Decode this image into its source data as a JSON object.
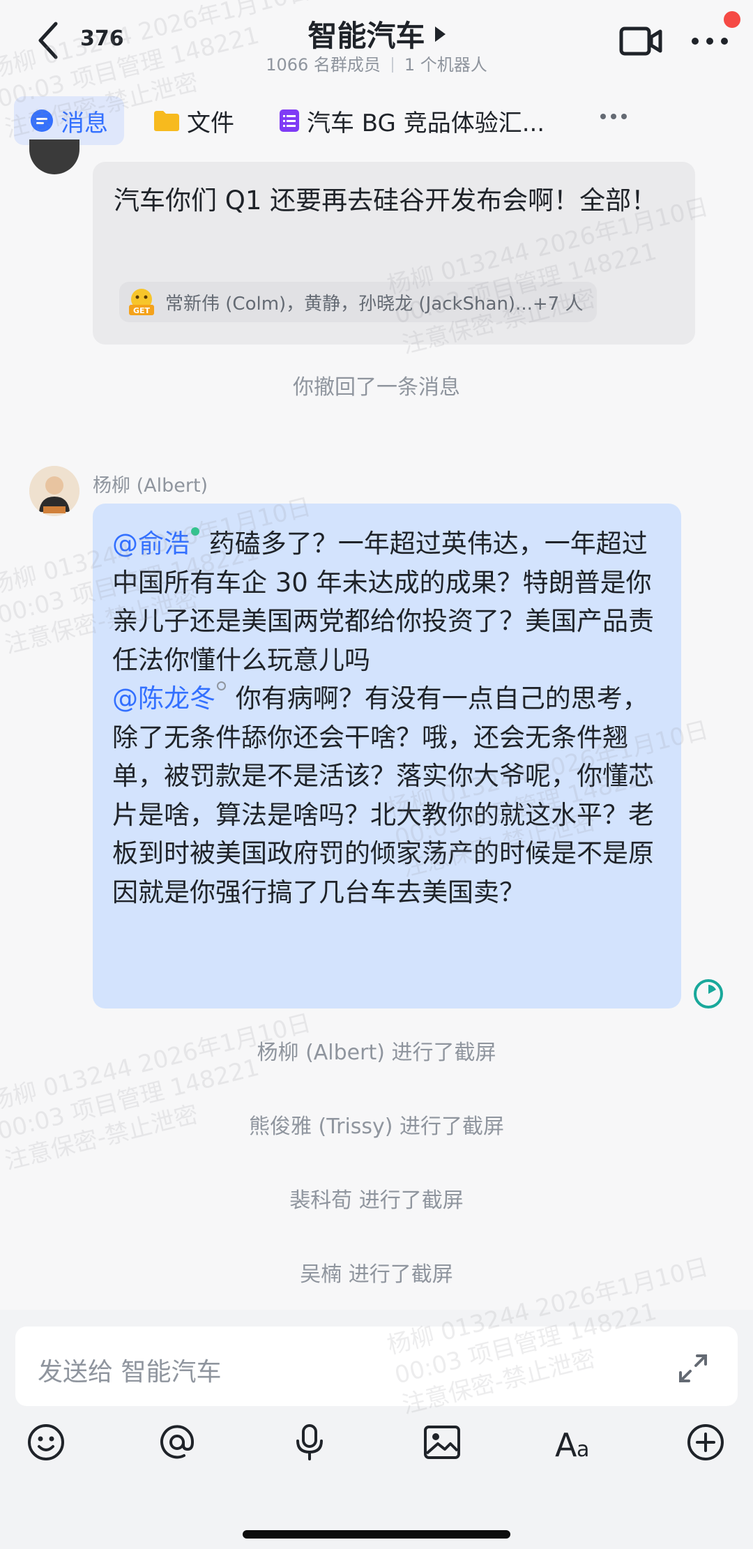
{
  "header": {
    "unread_count": "376",
    "title": "智能汽车",
    "member_count": "1066 名群成员",
    "bot_count": "1 个机器人"
  },
  "tabs": [
    {
      "label": "消息",
      "icon": "chat-bubble-icon",
      "active": true
    },
    {
      "label": "文件",
      "icon": "folder-icon",
      "active": false
    },
    {
      "label": "汽车 BG 竞品体验汇...",
      "icon": "doc-icon",
      "active": false
    }
  ],
  "messages": [
    {
      "text": "汽车你们 Q1 还要再去硅谷开发布会啊！全部！",
      "reaction": {
        "emoji": "get-emoji-icon",
        "users": "常新伟 (Colm)，黄静，孙晓龙 (JackShan)...+7 人"
      }
    },
    {
      "sender": "杨柳 (Albert)",
      "mention1": "@俞浩",
      "part1": " 药磕多了？一年超过英伟达，一年超过中国所有车企 30 年未达成的成果？特朗普是你亲儿子还是美国两党都给你投资了？美国产品责任法你懂什么玩意儿吗",
      "mention2": "@陈龙冬",
      "part2": " 你有病啊？有没有一点自己的思考，除了无条件舔你还会干啥？哦，还会无条件翘单，被罚款是不是活该？落实你大爷呢，你懂芯片是啥，算法是啥吗？北大教你的就这水平？老板到时被美国政府罚的倾家荡产的时候是不是原因就是你强行搞了几台车去美国卖？"
    }
  ],
  "system_messages": [
    "你撤回了一条消息",
    "杨柳 (Albert) 进行了截屏",
    "熊俊雅 (Trissy) 进行了截屏",
    "裴科荀 进行了截屏",
    "吴楠 进行了截屏"
  ],
  "input": {
    "placeholder": "发送给 智能汽车"
  },
  "watermark": {
    "line1": "杨柳 013244 2026年1月10日",
    "line2": "00:03 项目管理 148221",
    "line3": "注意保密-禁止泄密"
  },
  "colors": {
    "accent": "#3370ff",
    "bubble_self": "#d3e3fd",
    "bubble_other": "#eaeaec",
    "badge": "#f54a45"
  }
}
